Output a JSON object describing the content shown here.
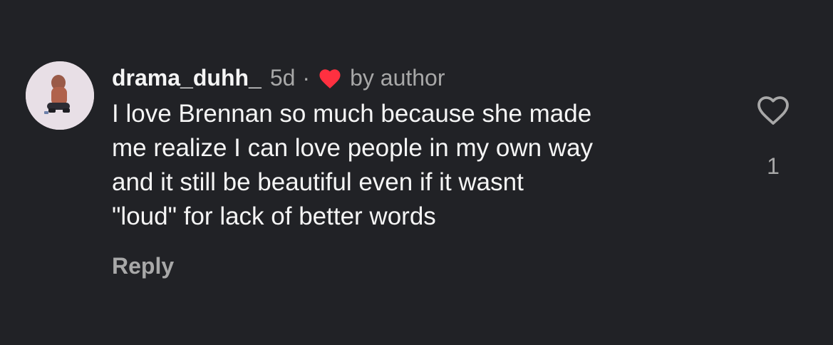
{
  "comment": {
    "username": "drama_duhh_",
    "time": "5d",
    "separator": "·",
    "badge_text": "by author",
    "badge_icon": "heart-filled-icon",
    "text": "I love Brennan so much because she made\nme realize I can love people in my own way\nand it still be beautiful even if it wasnt\n\"loud\" for lack of better words",
    "reply_label": "Reply",
    "like_icon": "heart-outline-icon",
    "like_count": "1"
  },
  "colors": {
    "background": "#212226",
    "primary_text": "#f5f5f5",
    "secondary_text": "#a8a8a8",
    "heart_red": "#ff3040"
  }
}
